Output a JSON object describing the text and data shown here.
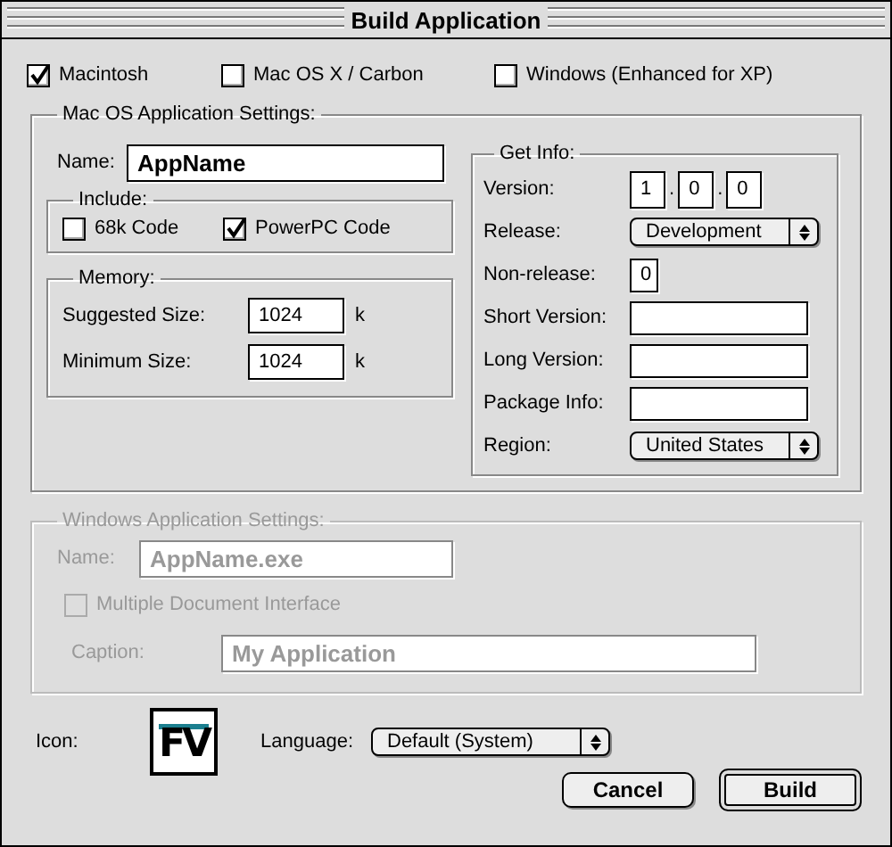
{
  "window": {
    "title": "Build Application"
  },
  "targets": [
    {
      "label": "Macintosh",
      "checked": true
    },
    {
      "label": "Mac OS X / Carbon",
      "checked": false
    },
    {
      "label": "Windows (Enhanced for XP)",
      "checked": false
    }
  ],
  "mac_settings": {
    "legend": "Mac OS Application Settings:",
    "name_label": "Name:",
    "name_value": "AppName",
    "include": {
      "legend": "Include:",
      "options": [
        {
          "label": "68k Code",
          "checked": false
        },
        {
          "label": "PowerPC Code",
          "checked": true
        }
      ]
    },
    "memory": {
      "legend": "Memory:",
      "rows": [
        {
          "label": "Suggested Size:",
          "value": "1024",
          "unit": "k"
        },
        {
          "label": "Minimum Size:",
          "value": "1024",
          "unit": "k"
        }
      ]
    },
    "get_info": {
      "legend": "Get Info:",
      "rows": [
        {
          "kind": "version",
          "label": "Version:",
          "parts": [
            {
              "kind": "field",
              "text": "1"
            },
            {
              "kind": "dot",
              "text": "."
            },
            {
              "kind": "field",
              "text": "0"
            },
            {
              "kind": "dot",
              "text": "."
            },
            {
              "kind": "field",
              "text": "0"
            }
          ]
        },
        {
          "kind": "select",
          "label": "Release:",
          "value": "Development"
        },
        {
          "kind": "small",
          "label": "Non-release:",
          "value": "0"
        },
        {
          "kind": "text",
          "label": "Short Version:"
        },
        {
          "kind": "text",
          "label": "Long Version:"
        },
        {
          "kind": "text",
          "label": "Package Info:"
        },
        {
          "kind": "select",
          "label": "Region:",
          "value": "United States"
        }
      ]
    }
  },
  "windows_settings": {
    "disabled": true,
    "legend": "Windows Application Settings:",
    "name_label": "Name:",
    "name_value": "AppName.exe",
    "mdi": {
      "label": "Multiple Document Interface",
      "checked": false
    },
    "caption_label": "Caption:",
    "caption_value": "My Application"
  },
  "icon": {
    "label": "Icon:",
    "glyph": "FV"
  },
  "language": {
    "label": "Language:",
    "value": "Default (System)"
  },
  "buttons": [
    {
      "label": "Cancel",
      "default": false
    },
    {
      "label": "Build",
      "default": true
    }
  ]
}
